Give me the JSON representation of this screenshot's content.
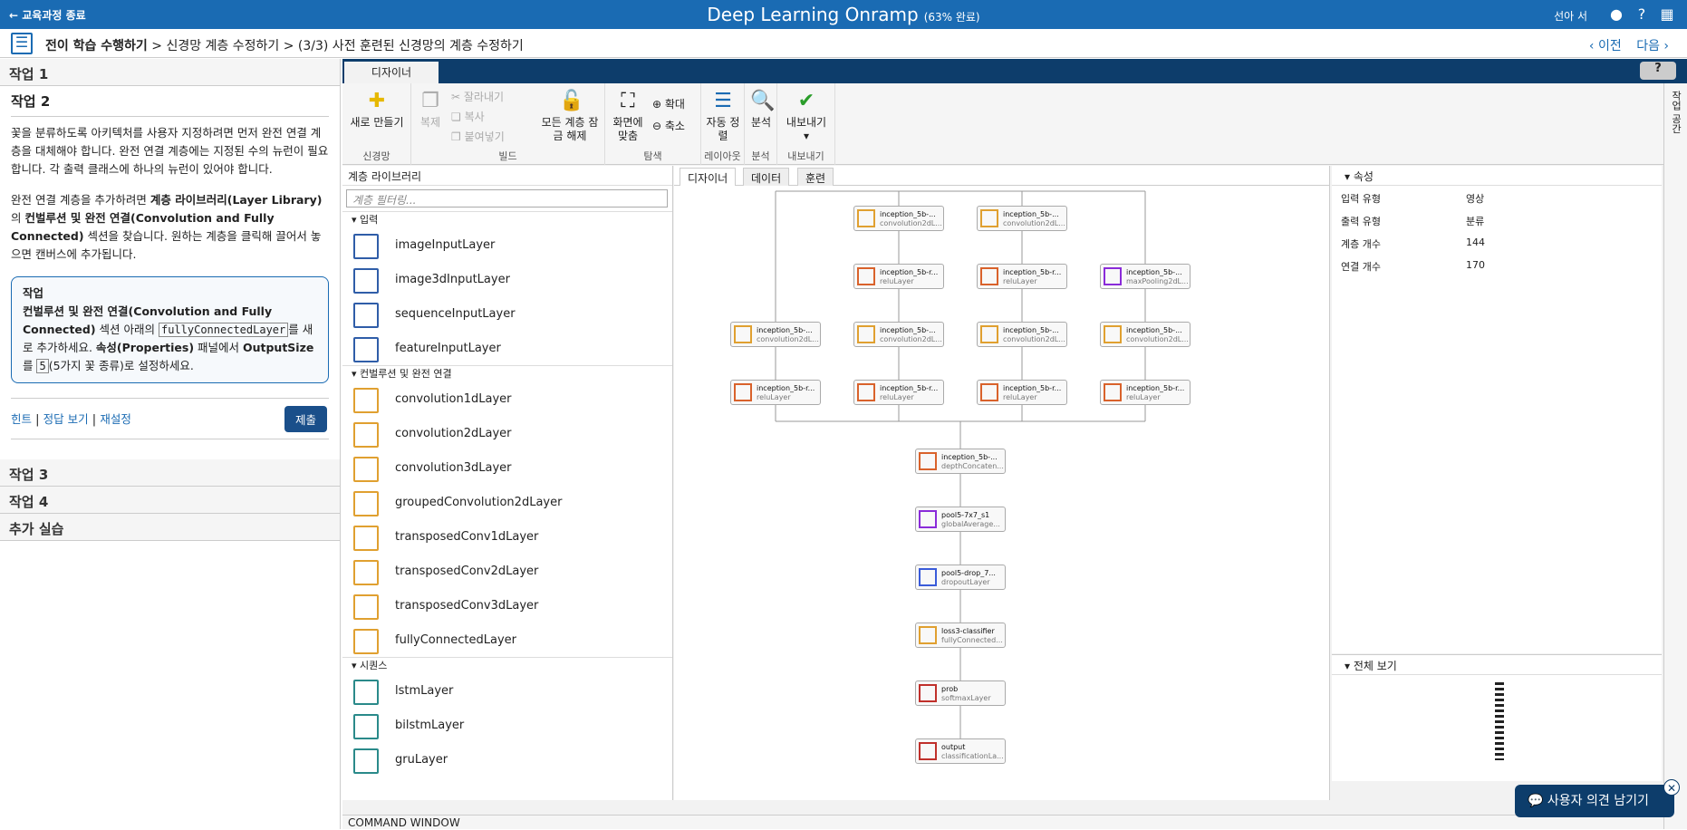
{
  "topbar": {
    "exit": "← 교육과정 종료",
    "title": "Deep Learning Onramp",
    "progress": "(63% 완료)",
    "user": "선아 서"
  },
  "crumbs": {
    "c1": "전이 학습 수행하기",
    "c2": "신경망 계층 수정하기",
    "c3": "(3/3) 사전 훈련된 신경망의 계층 수정하기",
    "sep": ">"
  },
  "nav": {
    "prev": "‹ 이전",
    "next": "다음 ›"
  },
  "left": {
    "task1": "작업 1",
    "task2": "작업 2",
    "p1": "꽃을 분류하도록 아키텍처를 사용자 지정하려면 먼저 완전 연결 계층을 대체해야 합니다. 완전 연결 계층에는 지정된 수의 뉴런이 필요합니다. 각 출력 클래스에 하나의 뉴런이 있어야 합니다.",
    "p2a": "완전 연결 계층을 추가하려면 ",
    "p2b": "계층 라이브러리(Layer Library)",
    "p2c": "의 ",
    "p2d": "컨벌루션 및 완전 연결(Convolution and Fully Connected)",
    "p2e": " 섹션을 찾습니다. 원하는 계층을 클릭해 끌어서 놓으면 캔버스에 추가됩니다.",
    "box_title": "작업",
    "box_a": "컨벌루션 및 완전 연결(Convolution and Fully Connected)",
    "box_b": " 섹션 아래의 ",
    "box_code": "fullyConnectedLayer",
    "box_c": "를 새로 추가하세요. ",
    "box_d": "속성(Properties)",
    "box_e": " 패널에서 ",
    "box_f": "OutputSize",
    "box_g": "를 ",
    "box_h": "5",
    "box_i": "(5가지 꽃 종류)로 설정하세요.",
    "hint": "힌트",
    "answer": "정답 보기",
    "reset": "재설정",
    "sep": " | ",
    "submit": "제출",
    "task3": "작업 3",
    "task4": "작업 4",
    "extra": "추가 실습"
  },
  "app": {
    "tab": "디자이너",
    "help": "?",
    "ribbon": {
      "new": "새로 만들기",
      "copy": "복제",
      "cut": "잘라내기",
      "dup": "복사",
      "paste": "붙여넣기",
      "unlock": "모든 계층 잠금 해제",
      "fit": "화면에 맞춤",
      "zoomin": "확대",
      "zoomout": "축소",
      "arrange": "자동 정렬",
      "analyze": "분석",
      "export": "내보내기",
      "g_net": "신경망",
      "g_build": "빌드",
      "g_nav": "탐색",
      "g_layout": "레이아웃",
      "g_anal": "분석",
      "g_exp": "내보내기"
    },
    "side": "작업 공간",
    "lib": {
      "head": "계층 라이브러리",
      "filter": "계층 필터링...",
      "cat_input": "입력",
      "cat_conv": "컨벌루션 및 완전 연결",
      "cat_seq": "시퀀스",
      "input": [
        "imageInputLayer",
        "image3dInputLayer",
        "sequenceInputLayer",
        "featureInputLayer"
      ],
      "conv": [
        "convolution1dLayer",
        "convolution2dLayer",
        "convolution3dLayer",
        "groupedConvolution2dLayer",
        "transposedConv1dLayer",
        "transposedConv2dLayer",
        "transposedConv3dLayer",
        "fullyConnectedLayer"
      ],
      "seq": [
        "lstmLayer",
        "bilstmLayer",
        "gruLayer"
      ]
    },
    "ctabs": [
      "디자이너",
      "데이터",
      "훈련"
    ],
    "nodes": {
      "c1": [
        "inception_5b-...",
        "convolution2dL..."
      ],
      "c2": [
        "inception_5b-...",
        "convolution2dL..."
      ],
      "r1": [
        "inception_5b-r...",
        "reluLayer"
      ],
      "r2": [
        "inception_5b-r...",
        "reluLayer"
      ],
      "m1": [
        "inception_5b-...",
        "maxPooling2dL..."
      ],
      "c3": [
        "inception_5b-...",
        "convolution2dL..."
      ],
      "c4": [
        "inception_5b-...",
        "convolution2dL..."
      ],
      "c5": [
        "inception_5b-...",
        "convolution2dL..."
      ],
      "c6": [
        "inception_5b-...",
        "convolution2dL..."
      ],
      "r3": [
        "inception_5b-r...",
        "reluLayer"
      ],
      "r4": [
        "inception_5b-r...",
        "reluLayer"
      ],
      "r5": [
        "inception_5b-r...",
        "reluLayer"
      ],
      "r6": [
        "inception_5b-r...",
        "reluLayer"
      ],
      "dc": [
        "inception_5b-...",
        "depthConcaten..."
      ],
      "gp": [
        "pool5-7x7_s1",
        "globalAverage..."
      ],
      "dr": [
        "pool5-drop_7...",
        "dropoutLayer"
      ],
      "fc": [
        "loss3-classifier",
        "fullyConnected..."
      ],
      "sm": [
        "prob",
        "softmaxLayer"
      ],
      "out": [
        "output",
        "classificationLa..."
      ]
    },
    "props": {
      "head": "속성",
      "rows": [
        [
          "입력 유형",
          "영상"
        ],
        [
          "출력 유형",
          "분류"
        ],
        [
          "계층 개수",
          "144"
        ],
        [
          "연결 개수",
          "170"
        ]
      ]
    },
    "overview": "전체 보기",
    "cmd": "COMMAND WINDOW"
  },
  "feedback": "사용자 의견 남기기",
  "colors": {
    "accent": "#1a6bb3",
    "dark": "#0d3d6b"
  }
}
